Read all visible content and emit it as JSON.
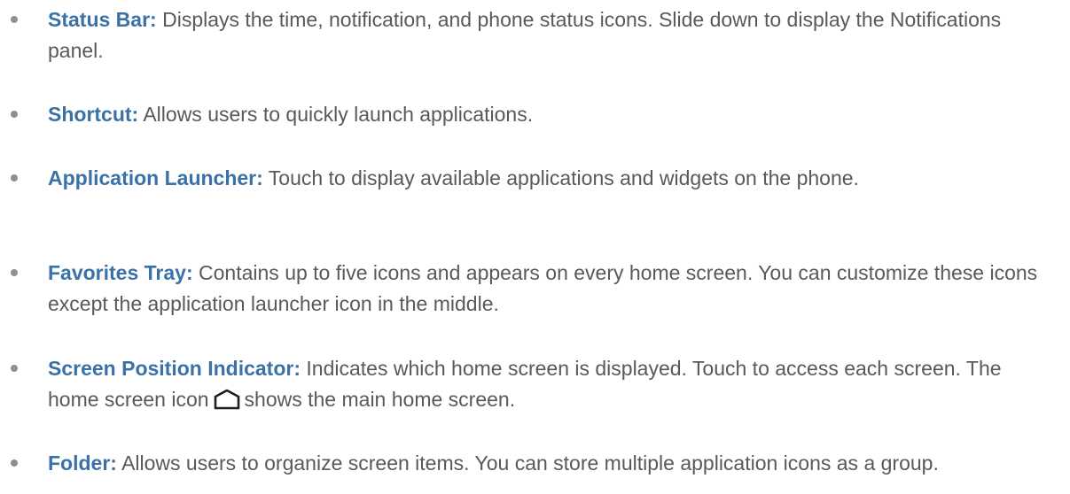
{
  "items": [
    {
      "term": "Status Bar:",
      "desc": " Displays the time, notification, and phone status icons. Slide down to display the Notifications panel."
    },
    {
      "term": "Shortcut:",
      "desc": " Allows users to quickly launch applications."
    },
    {
      "term": "Application Launcher:",
      "desc": " Touch to display available applications and widgets on the phone."
    },
    {
      "term": "Favorites Tray:",
      "desc": " Contains up to five icons and appears on every home screen. You can customize these icons except the application launcher icon in the middle."
    },
    {
      "term": "Screen Position Indicator:",
      "desc_before": " Indicates which home screen is displayed. Touch to access each screen. The home screen icon",
      "desc_after": "shows the main home screen.",
      "icon": "home-outline-icon"
    },
    {
      "term": "Folder:",
      "desc": " Allows users to organize screen items. You can store multiple application icons as a group."
    }
  ],
  "colors": {
    "term": "#3a72a8",
    "text": "#58595b",
    "bullet": "#8d8f92"
  }
}
